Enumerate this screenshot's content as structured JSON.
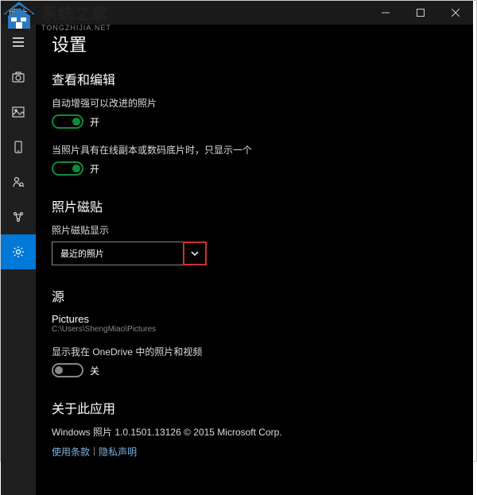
{
  "watermark": {
    "cn": "系统之家",
    "en": "TONGZHIJIA.NET"
  },
  "titlebar": {
    "title": "照片"
  },
  "page": {
    "title": "设置"
  },
  "sections": {
    "view_edit": {
      "title": "查看和编辑",
      "auto_enhance": {
        "label": "自动增强可以改进的照片",
        "state_text": "开"
      },
      "dup_photos": {
        "label": "当照片具有在线副本或数码底片时，只显示一个",
        "state_text": "开"
      }
    },
    "tile": {
      "title": "照片磁贴",
      "dropdown_label": "照片磁贴显示",
      "dropdown_value": "最近的照片"
    },
    "sources": {
      "title": "源",
      "folder_title": "Pictures",
      "folder_path": "C:\\Users\\ShengMiao\\Pictures",
      "onedrive": {
        "label": "显示我在 OneDrive 中的照片和视频",
        "state_text": "关"
      }
    },
    "about": {
      "title": "关于此应用",
      "version_line": "Windows 照片 1.0.1501.13126 © 2015 Microsoft Corp.",
      "link_terms": "使用条款",
      "link_privacy": "隐私声明",
      "sep": "|"
    }
  }
}
